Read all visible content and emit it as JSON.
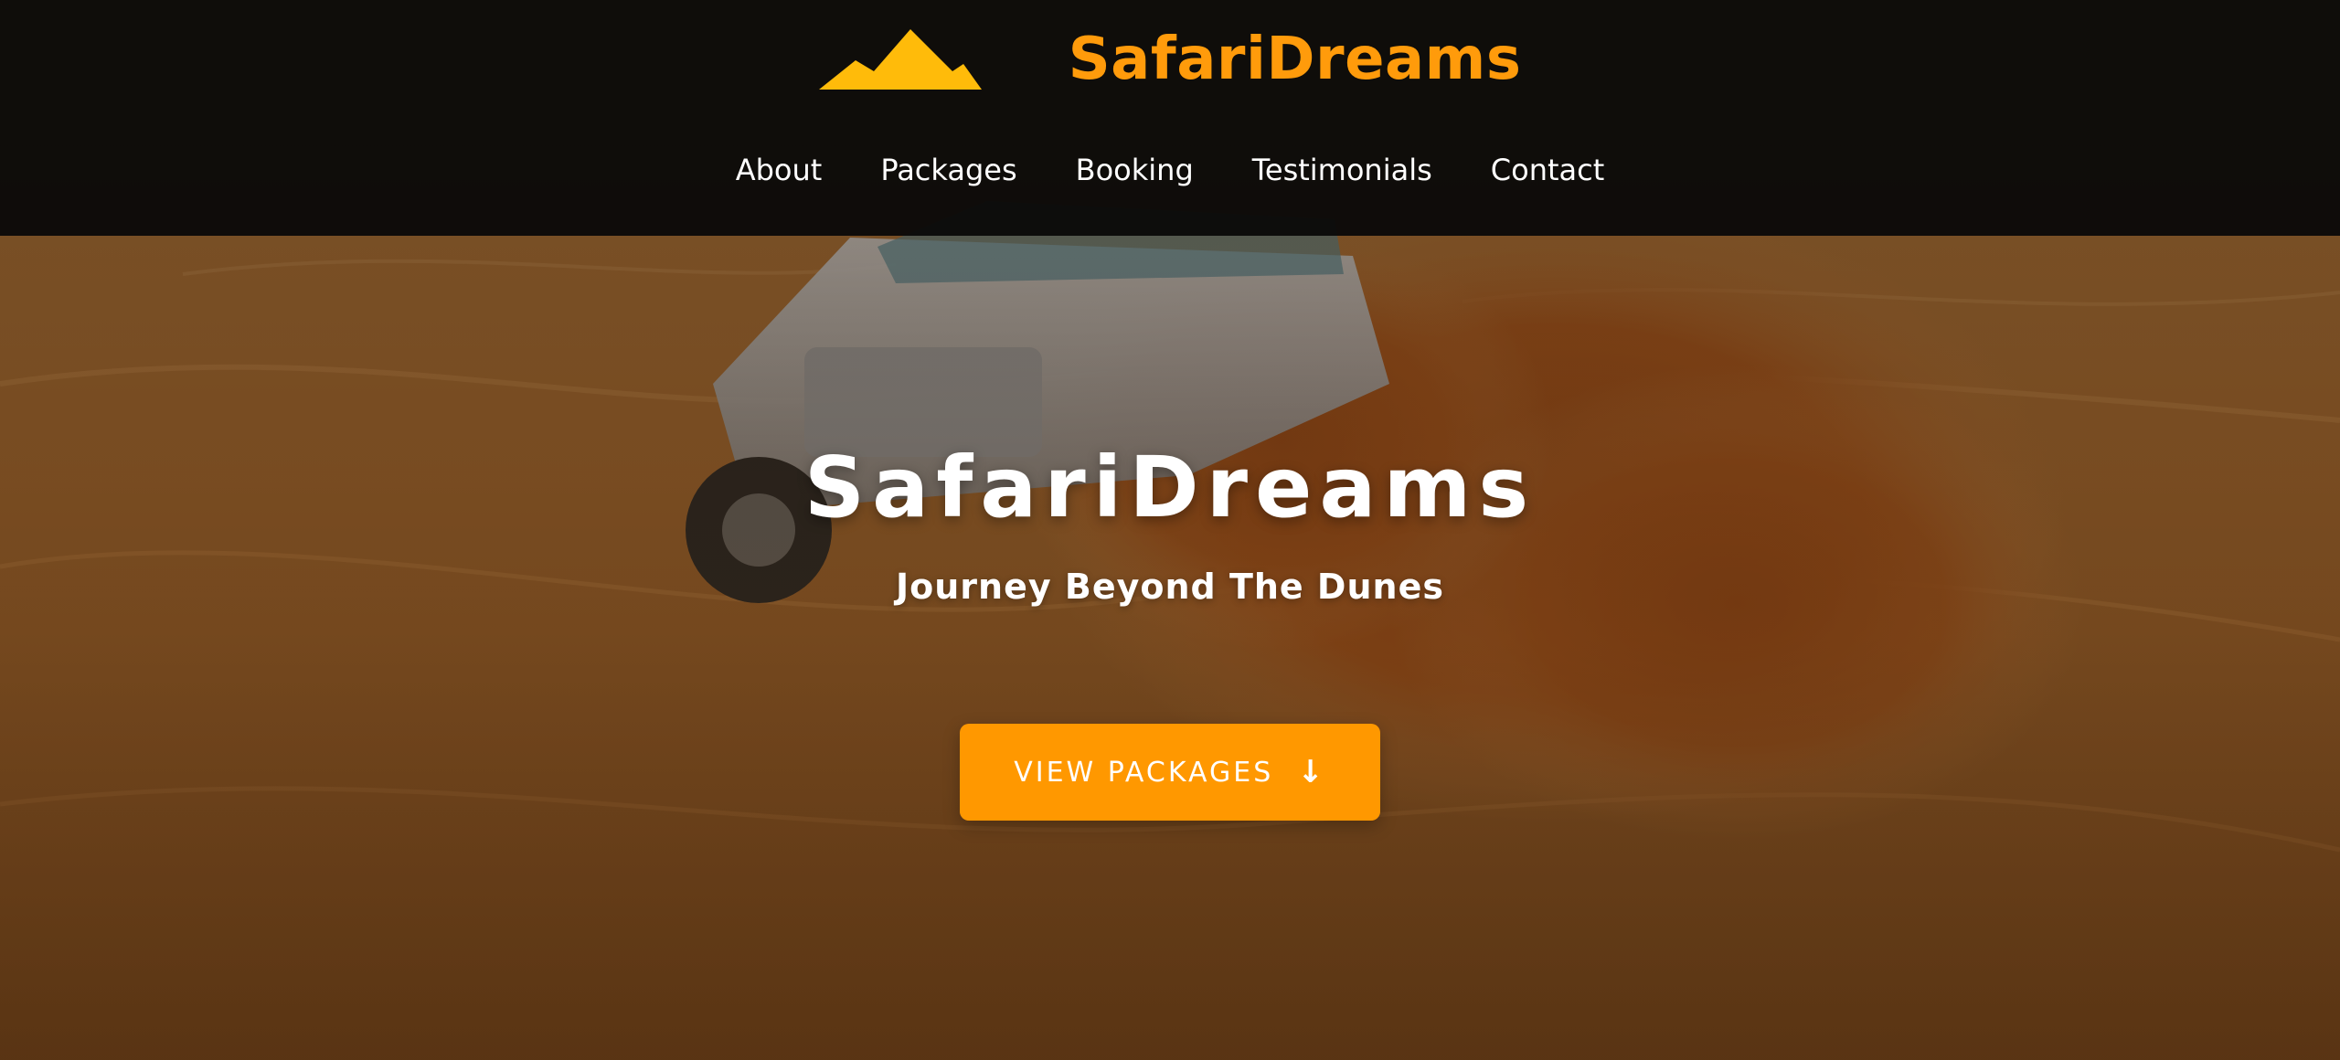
{
  "header": {
    "logo_icon": "mountain-icon",
    "brand_name": "SafariDreams",
    "nav": [
      {
        "label": "About"
      },
      {
        "label": "Packages"
      },
      {
        "label": "Booking"
      },
      {
        "label": "Testimonials"
      },
      {
        "label": "Contact"
      }
    ]
  },
  "hero": {
    "title": "SafariDreams",
    "subtitle": "Journey Beyond The Dunes",
    "cta_label": "VIEW PACKAGES",
    "cta_icon": "arrow-down-icon",
    "background": "desert-suv-dunes-photo"
  },
  "colors": {
    "accent": "#ff9800",
    "brand_text": "#ff9b0b",
    "header_bg": "#0b0b0b",
    "logo_fill": "#ffbb0a"
  }
}
